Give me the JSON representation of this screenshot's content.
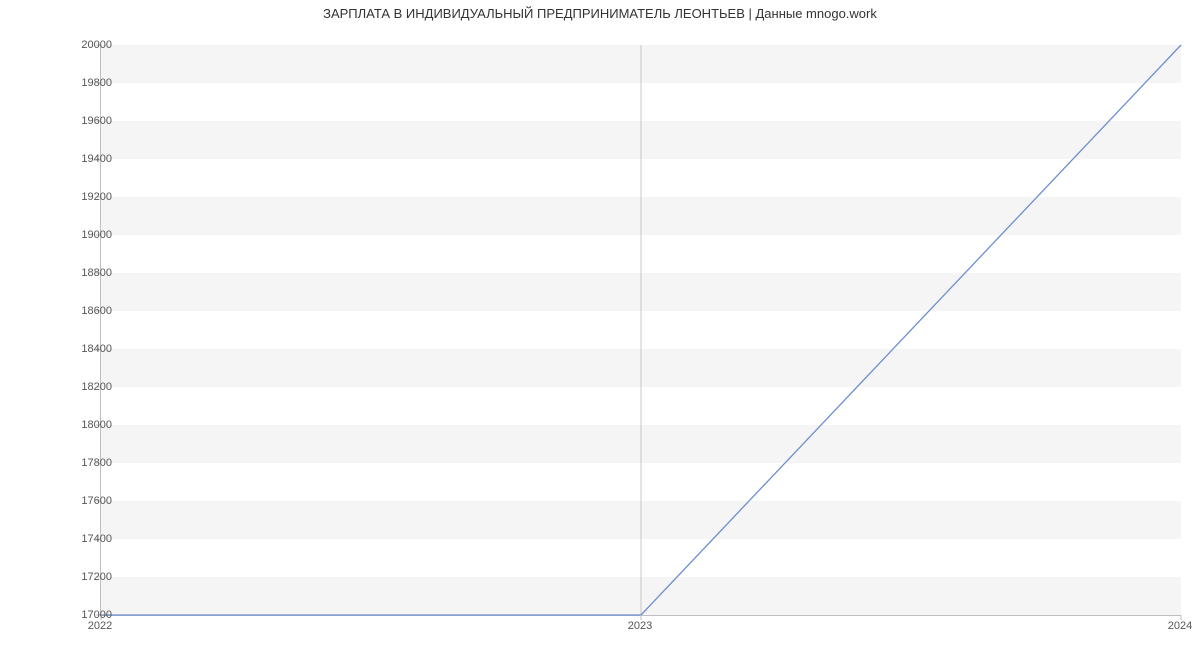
{
  "chart_data": {
    "type": "line",
    "title": "ЗАРПЛАТА В ИНДИВИДУАЛЬНЫЙ ПРЕДПРИНИМАТЕЛЬ ЛЕОНТЬЕВ | Данные mnogo.work",
    "x": [
      2022,
      2023,
      2024
    ],
    "values": [
      17000,
      17000,
      20000
    ],
    "xlabel": "",
    "ylabel": "",
    "x_ticks": [
      2022,
      2023,
      2024
    ],
    "y_ticks": [
      17000,
      17200,
      17400,
      17600,
      17800,
      18000,
      18200,
      18400,
      18600,
      18800,
      19000,
      19200,
      19400,
      19600,
      19800,
      20000
    ],
    "xlim": [
      2022,
      2024
    ],
    "ylim": [
      17000,
      20000
    ],
    "grid": true
  }
}
